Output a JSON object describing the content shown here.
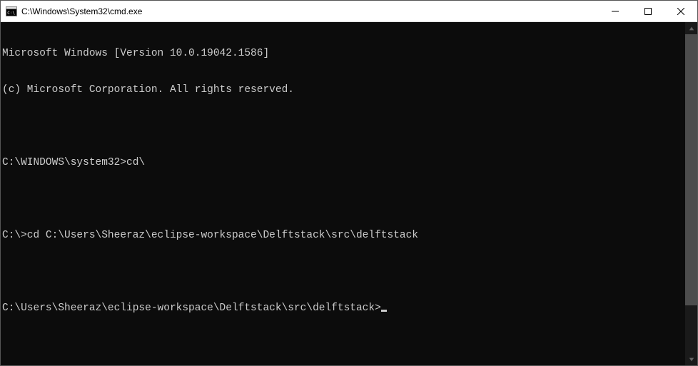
{
  "window": {
    "title": "C:\\Windows\\System32\\cmd.exe"
  },
  "terminal": {
    "lines": [
      "Microsoft Windows [Version 10.0.19042.1586]",
      "(c) Microsoft Corporation. All rights reserved.",
      "",
      "C:\\WINDOWS\\system32>cd\\",
      "",
      "C:\\>cd C:\\Users\\Sheeraz\\eclipse-workspace\\Delftstack\\src\\delftstack",
      "",
      "C:\\Users\\Sheeraz\\eclipse-workspace\\Delftstack\\src\\delftstack>"
    ]
  }
}
